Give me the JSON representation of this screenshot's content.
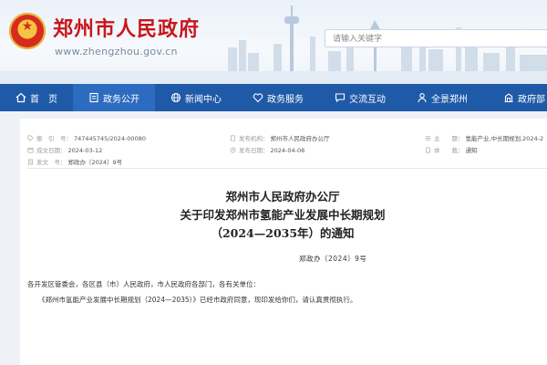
{
  "header": {
    "site_title": "郑州市人民政府",
    "site_domain": "www.zhengzhou.gov.cn",
    "search_placeholder": "请输入关键字"
  },
  "nav": {
    "items": [
      {
        "label": "首　页",
        "icon": "home-icon"
      },
      {
        "label": "政务公开",
        "icon": "document-icon"
      },
      {
        "label": "新闻中心",
        "icon": "globe-icon"
      },
      {
        "label": "政务服务",
        "icon": "heart-icon"
      },
      {
        "label": "交流互动",
        "icon": "chat-icon"
      },
      {
        "label": "全景郑州",
        "icon": "person-icon"
      },
      {
        "label": "政府部",
        "icon": "building-icon"
      }
    ],
    "active_index": 1
  },
  "meta": {
    "index_no_label": "索　引　号：",
    "index_no": "747445745/2024-00080",
    "issuer_label": "发布机构：",
    "issuer": "郑州市人民政府办公厅",
    "topic_label": "主　　题：",
    "topic": "氢能产业,中长期规划,2024-2",
    "written_date_label": "成文日期：",
    "written_date": "2024-03-12",
    "publish_date_label": "发布日期：",
    "publish_date": "2024-04-08",
    "doc_type_label": "体　　裁：",
    "doc_type": "通知",
    "doc_no_label": "发文　号：",
    "doc_no": "郑政办〔2024〕9号"
  },
  "document": {
    "title_line1": "郑州市人民政府办公厅",
    "title_line2": "关于印发郑州市氢能产业发展中长期规划",
    "title_line3": "（2024—2035年）的通知",
    "doc_number": "郑政办〔2024〕9号",
    "salutation": "各开发区管委会，各区县（市）人民政府，市人民政府各部门，各有关单位：",
    "body_p1": "《郑州市氢能产业发展中长期规划（2024—2035）》已经市政府同意，现印发给你们，请认真贯彻执行。"
  },
  "colors": {
    "brand_red": "#c8161d",
    "nav_blue": "#1f5aa8",
    "nav_active": "#2c6cc0"
  }
}
